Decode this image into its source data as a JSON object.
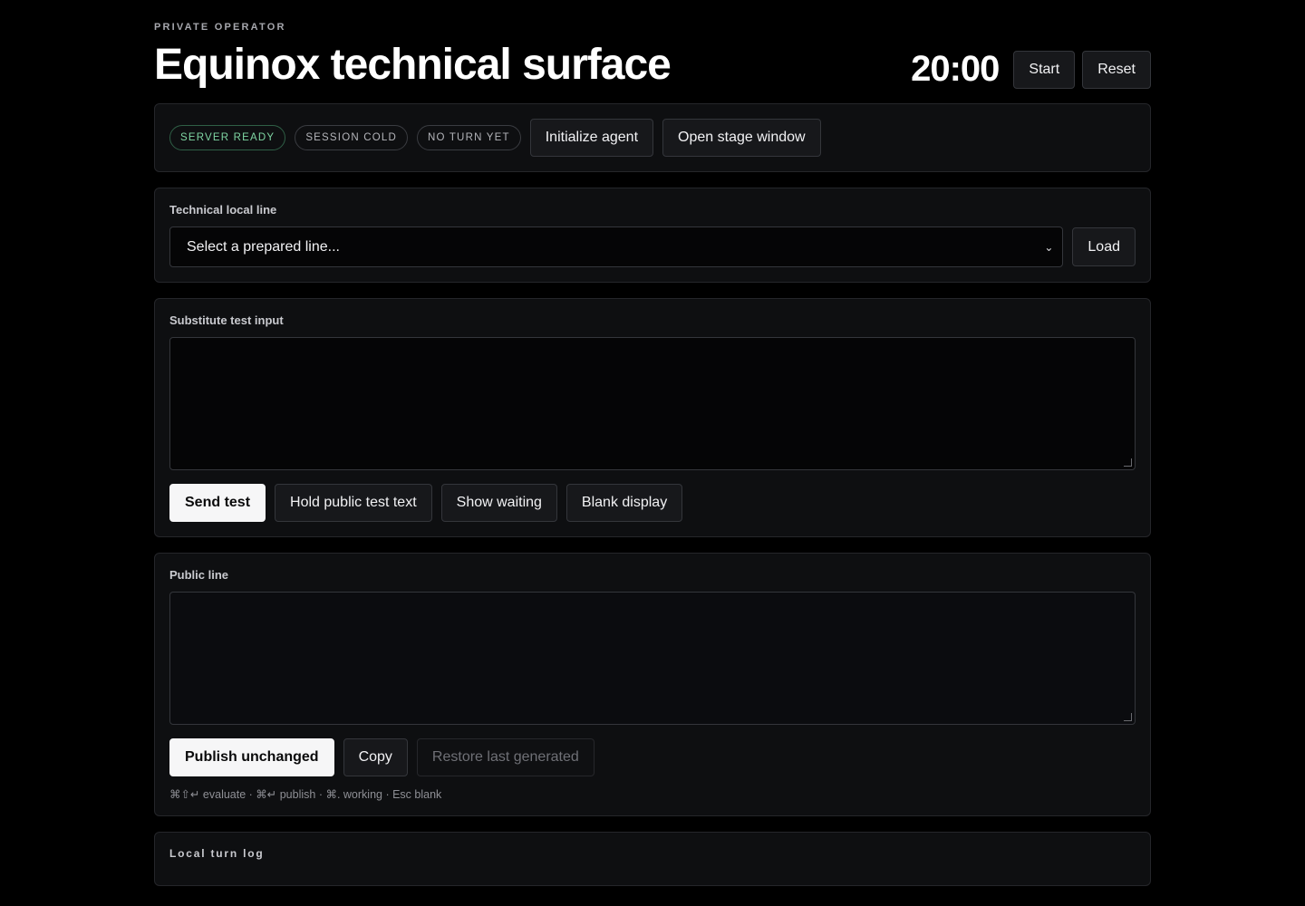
{
  "header": {
    "eyebrow": "PRIVATE OPERATOR",
    "title": "Equinox technical surface",
    "timer": "20:00",
    "start_label": "Start",
    "reset_label": "Reset"
  },
  "status": {
    "pills": [
      "SERVER READY",
      "SESSION COLD",
      "NO TURN YET"
    ],
    "initialize_label": "Initialize agent",
    "open_stage_label": "Open stage window"
  },
  "technical_line": {
    "label": "Technical local line",
    "select_value": "Select a prepared line...",
    "load_label": "Load"
  },
  "substitute": {
    "label": "Substitute test input",
    "value": "",
    "send_label": "Send test",
    "hold_label": "Hold public test text",
    "waiting_label": "Show waiting",
    "blank_label": "Blank display"
  },
  "public_line": {
    "label": "Public line",
    "value": "",
    "publish_label": "Publish unchanged",
    "copy_label": "Copy",
    "restore_label": "Restore last generated",
    "shortcuts_hint": "⌘⇧↵ evaluate · ⌘↵ publish · ⌘. working · Esc blank"
  },
  "log": {
    "label": "Local turn log"
  },
  "colors": {
    "background": "#000000",
    "panel": "#0e0f11",
    "ready_green": "#7fd6a3"
  }
}
